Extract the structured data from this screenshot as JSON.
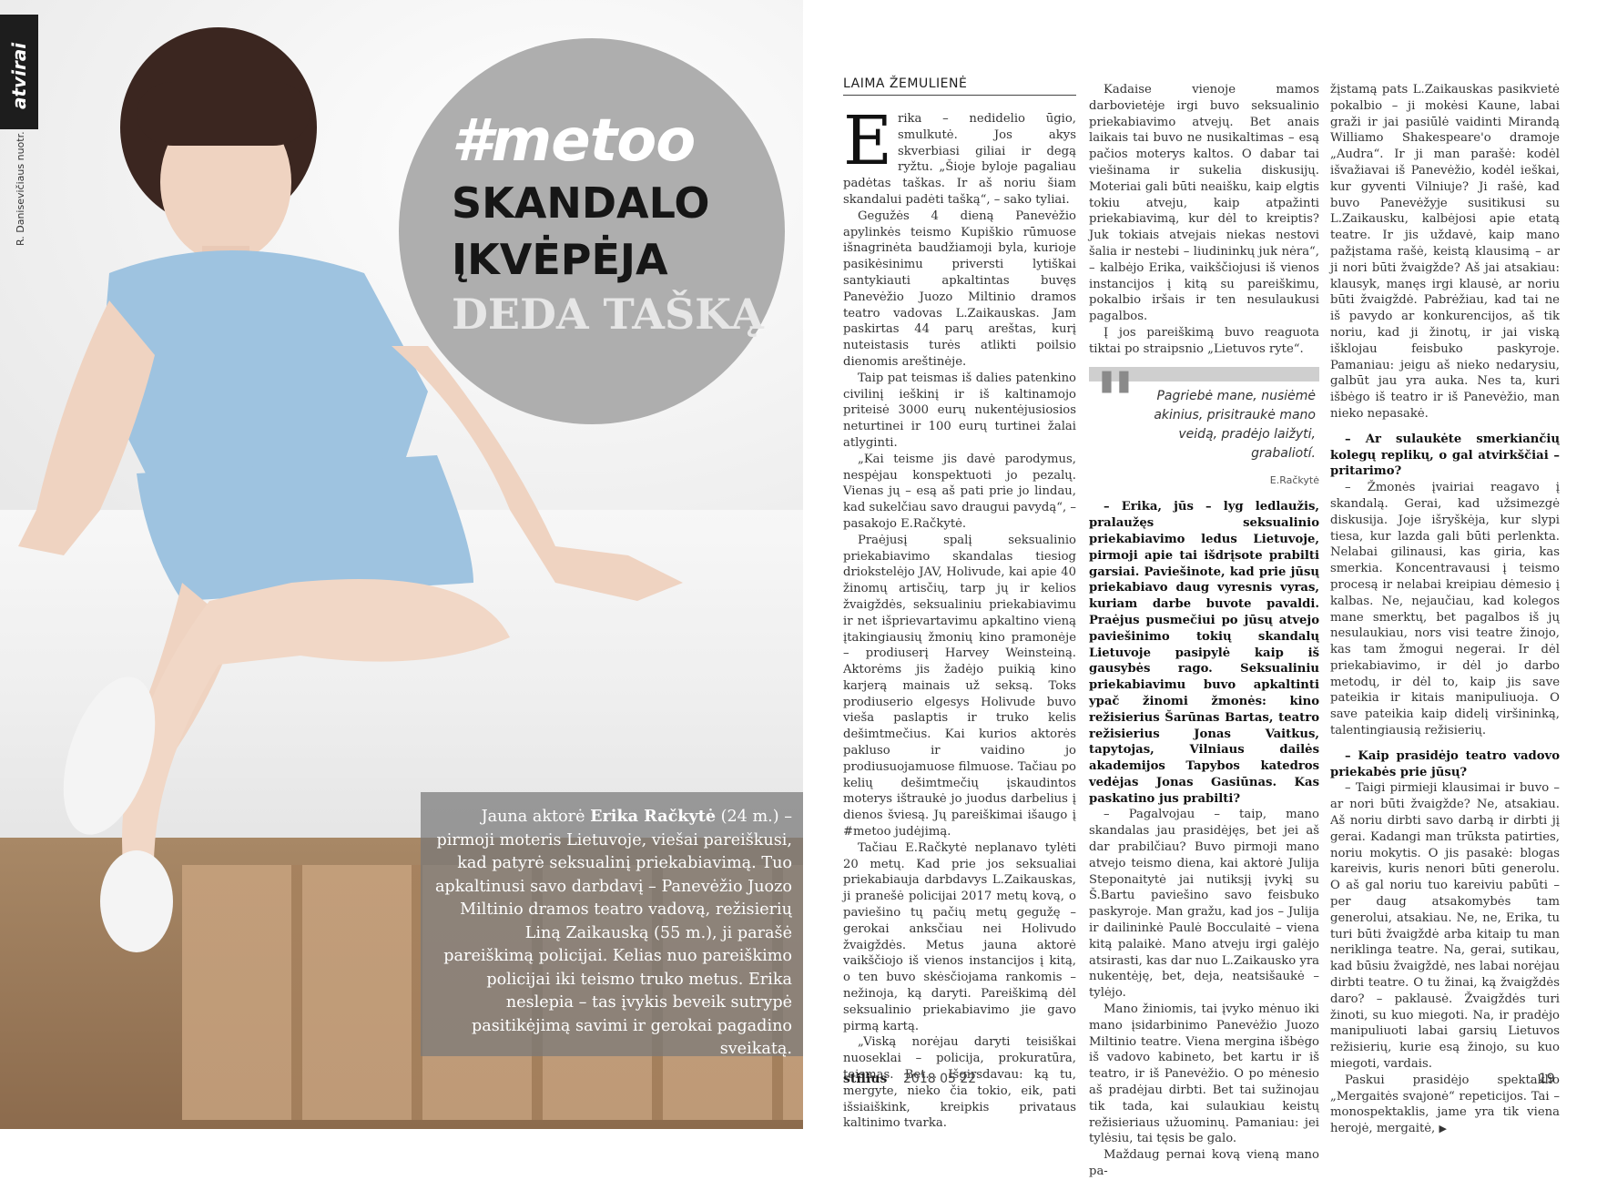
{
  "section_tab": "atvirai",
  "photo_credit": "R. Danisevičiaus nuotr.",
  "headline": {
    "tag": "#metoo",
    "line1": "SKANDALO",
    "line2": "ĮKVĖPĖJA",
    "line3": "DEDA TAŠKĄ"
  },
  "caption": {
    "lead": "Jauna aktorė ",
    "name": "Erika Račkytė",
    "rest": " (24 m.) – pirmoji moteris Lietuvoje, viešai pareiškusi, kad patyrė seksualinį priekabiavimą. Tuo apkaltinusi savo darbdavį – Panevėžio Juozo Miltinio dramos teatro vadovą, režisierių Liną Zaikauską (55 m.), ji parašė pareiškimą policijai. Kelias nuo pareiškimo policijai iki teismo truko metus. Erika neslepia – tas įvykis beveik sutrypė pasitikėjimą savimi ir gerokai pagadino sveikatą."
  },
  "author": "LAIMA ŽEMULIENĖ",
  "col1": {
    "dropcap": "E",
    "p1": "rika – nedidelio ūgio, smulkutė. Jos akys skverbiasi giliai ir degą ryžtu. „Šioje byloje pagaliau padėtas taškas. Ir aš noriu šiam skandalui padėti tašką“, – sako tyliai.",
    "p2": "Gegužės 4 dieną Panevėžio apylinkės teismo Kupiškio rūmuose išnagrinėta baudžiamoji byla, kurioje pasikėsinimu priversti lytiškai santykiauti apkaltintas buvęs Panevėžio Juozo Miltinio dramos teatro vadovas L.Zaikauskas. Jam paskirtas 44 parų areštas, kurį nuteistasis turės atlikti poilsio dienomis areštinėje.",
    "p3": "Taip pat teismas iš dalies patenkino civilinį ieškinį ir iš kaltinamojo priteisė 3000 eurų nukentėjusiosios neturtinei ir 100 eurų turtinei žalai atlyginti.",
    "p4": "„Kai teisme jis davė parodymus, nespėjau konspektuoti jo pezalų. Vienas jų – esą aš pati prie jo lindau, kad sukelčiau savo draugui pavydą“, – pasakojo E.Račkytė.",
    "p5": "Praėjusį spalį seksualinio priekabiavimo skandalas tiesiog driokstelėjo JAV, Holivude, kai apie 40 žinomų artisčių, tarp jų ir kelios žvaigždės, seksualiniu priekabiavimu ir net išprievartavimu apkaltino vieną įtakingiausių žmonių kino pramonėje – prodiuserį Harvey Weinsteiną. Aktorėms jis žadėjo puikią kino karjerą mainais už seksą. Toks prodiuserio elgesys Holivude buvo vieša paslaptis ir truko kelis dešimtmečius. Kai kurios aktorės pakluso ir vaidino jo prodiusuojamuose filmuose. Tačiau po kelių dešimtmečių įskaudintos moterys ištraukė jo juodus darbelius į dienos šviesą. Jų pareiškimai išaugo į #metoo judėjimą.",
    "p6": "Tačiau E.Račkytė neplanavo tylėti 20 metų. Kad prie jos seksualiai priekabiauja darbdavys L.Zaikauskas, ji pranešė policijai 2017 metų kovą, o paviešino tų pačių metų gegužę – gerokai anksčiau nei Holivudo žvaigždės. Metus jauna aktorė vaikščiojo iš vienos instancijos į kitą, o ten buvo skėsčiojama rankomis – nežinoja, ką daryti. Pareiškimą dėl seksualinio priekabiavimo jie gavo pirmą kartą.",
    "p7": "„Viską norėjau daryti teisiškai nuoseklai – policija, prokuratūra, teismas. Bet... Išgirsdavau: ką tu, mergyte, nieko čia tokio, eik, pati išsiaiškink, kreipkis privataus kaltinimo tvarka."
  },
  "col2": {
    "p1": "Kadaise vienoje mamos darbovietėje irgi buvo seksualinio priekabiavimo atvejų. Bet anais laikais tai buvo ne nusikaltimas – esą pačios moterys kaltos. O dabar tai viešinama ir sukelia diskusijų. Moteriai gali būti neaišku, kaip elgtis tokiu atveju, kaip atpažinti priekabiavimą, kur dėl to kreiptis? Juk tokiais atvejais niekas nestovi šalia ir nestebi – liudininkų juk nėra“, – kalbėjo Erika, vaikščiojusi iš vienos instancijos į kitą su pareiškimu, pokalbio iršais ir ten nesulaukusi pagalbos.",
    "p2": "Į jos pareiškimą buvo reaguota tiktai po straipsnio „Lietuvos ryte“.",
    "quote": "Pagriebė mane, nusiėmė akinius, prisitraukė mano veidą, pradėjo laižyti, grabaliotí.",
    "quote_author": "E.Račkytė",
    "q1": "– Erika, jūs – lyg ledlaužis, pralaužęs seksualinio priekabiavimo ledus Lietuvoje, pirmoji apie tai išdrįsote prabilti garsiai. Paviešinote, kad prie jūsų priekabiavo daug vyresnis vyras, kuriam darbe buvote pavaldi. Praėjus pusmečiui po jūsų atvejo paviešinimo tokių skandalų Lietuvoje pasipylė kaip iš gausybės rago. Seksualiniu priekabiavimu buvo apkaltinti ypač žinomi žmonės: kino režisierius Šarūnas Bartas, teatro režisierius Jonas Vaitkus, tapytojas, Vilniaus dailės akademijos Tapybos katedros vedėjas Jonas Gasiūnas. Kas paskatino jus prabilti?",
    "a1": "– Pagalvojau – taip, mano skandalas jau prasidėjęs, bet jei aš dar prabilčiau? Buvo pirmoji mano atvejo teismo diena, kai aktorė Julija Steponaitytė jai nutiksjį įvykį su Š.Bartu paviešino savo feisbuko paskyroje. Man gražu, kad jos – Julija ir dailininkė Paulė Bocculaitė – viena kitą palaikė. Mano atveju irgi galėjo atsirasti, kas dar nuo L.Zaikausko yra nukentėję, bet, deja, neatsišaukė – tylėjo.",
    "a2": "Mano žiniomis, tai įvyko mėnuo iki mano įsidarbinimo Panevėžio Juozo Miltinio teatre. Viena mergina išbėgo iš vadovo kabineto, bet kartu ir iš teatro, ir iš Panevėžio. O po mėnesio aš pradėjau dirbti. Bet tai sužinojau tik tada, kai sulaukiau keistų režisieriaus užuominų. Pamaniau: jei tylėsiu, tai tęsis be galo.",
    "a3": "Maždaug pernai kovą vieną mano pa-"
  },
  "col3": {
    "p1": "žįstamą pats L.Zaikauskas pasikvietė pokalbio – ji mokėsi Kaune, labai graži ir jai pasiūlė vaidinti Mirandą Williamo Shakespeare'o dramoje „Audra“. Ir ji man parašė: kodėl išvažiavai iš Panevėžio, kodėl ieškai, kur gyventi Vilniuje? Ji rašė, kad buvo Panevėžyje susitikusi su L.Zaikausku, kalbėjosi apie etatą teatre. Ir jis uždavė, kaip mano pažįstama rašė, keistą klausimą – ar ji nori būti žvaigžde? Aš jai atsakiau: klausyk, manęs irgi klausė, ar noriu būti žvaigždė. Pabrėžiau, kad tai ne iš pavydo ar konkurencijos, aš tik noriu, kad ji žinotų, ir jai viską išklojau feisbuko paskyroje. Pamaniau: jeigu aš nieko nedarysiu, galbūt jau yra auka. Nes ta, kuri išbėgo iš teatro ir iš Panevėžio, man nieko nepasakė.",
    "q1": "– Ar sulaukėte smerkiančių kolegų replikų, o gal atvirkščiai – pritarimo?",
    "a1": "– Žmonės įvairiai reagavo į skandalą. Gerai, kad užsimezgė diskusija. Joje išryškėja, kur slypi tiesa, kur lazda gali būti perlenkta. Nelabai gilinausi, kas giria, kas smerkia. Koncentravausi į teismo procesą ir nelabai kreipiau dėmesio į kalbas. Ne, nejaučiau, kad kolegos mane smerktų, bet pagalbos iš jų nesulaukiau, nors visi teatre žinojo, kas tam žmogui negerai. Ir dėl priekabiavimo, ir dėl jo darbo metodų, ir dėl to, kaip jis save pateikia ir kitais manipuliuoja. O save pateikia kaip didelį viršininką, talentingiausią režisierių.",
    "q2": "– Kaip prasidėjo teatro vadovo priekabės prie jūsų?",
    "a2": "– Taigi pirmieji klausimai ir buvo – ar nori būti žvaigžde? Ne, atsakiau. Aš noriu dirbti savo darbą ir dirbti jį gerai. Kadangi man trūksta patirties, noriu mokytis. O jis pasakė: blogas kareivis, kuris nenori būti generolu. O aš gal noriu tuo kareiviu pabūti – per daug atsakomybės tam generolui, atsakiau. Ne, ne, Erika, tu turi būti žvaigždė arba kitaip tu man neriklinga teatre. Na, gerai, sutikau, kad būsiu žvaigždė, nes labai norėjau dirbti teatre. O tu žinai, ką žvaigždės daro? – paklausė. Žvaigždės turi žinoti, su kuo miegoti. Na, ir pradėjo manipuliuoti labai garsių Lietuvos režisierių, kurie esą žinojo, su kuo miegoti, vardais.",
    "a3": "Paskui prasidėjo spektaklio „Mergaitės svajonė“ repeticijos. Tai – monospektaklis, jame yra tik viena herojė, mergaitė,",
    "arrow": "▶"
  },
  "footer": {
    "brand": "stilius",
    "date": "2018 05 22",
    "page": "19"
  },
  "colors": {
    "circle": "#aeaeae",
    "caption_box": "#787878",
    "tab": "#1d1d1d"
  }
}
